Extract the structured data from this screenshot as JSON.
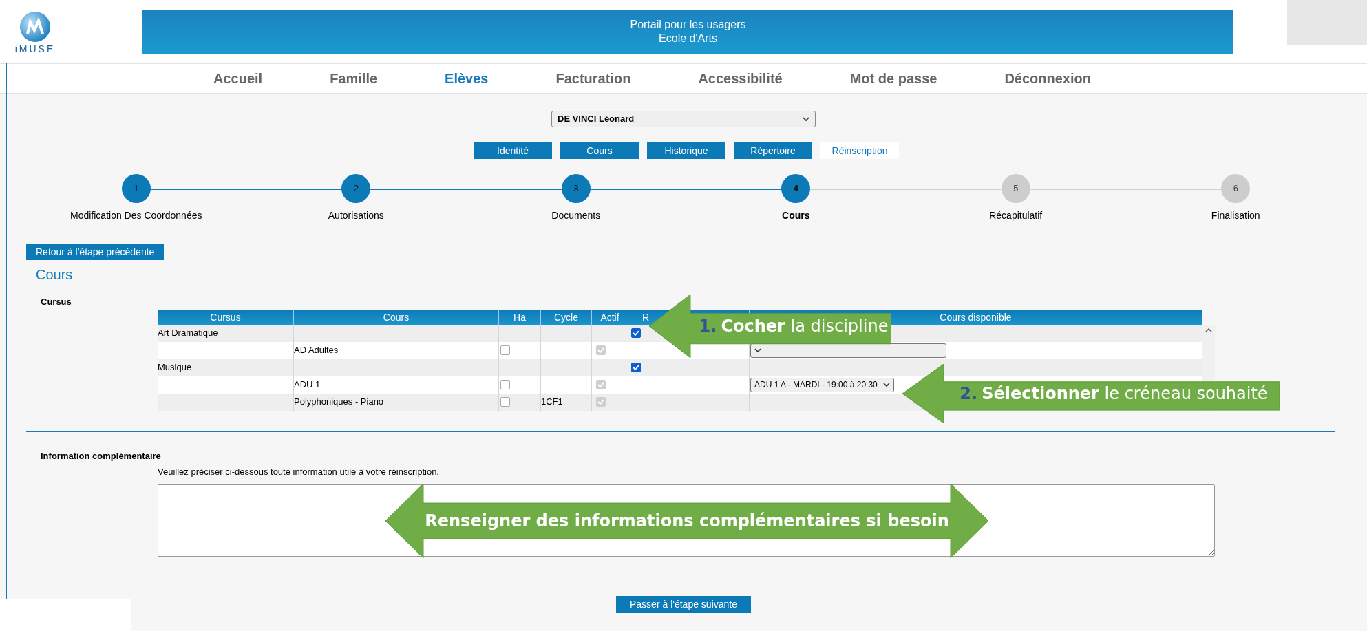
{
  "banner": {
    "title": "Portail pour les usagers",
    "subtitle": "Ecole d'Arts"
  },
  "logo": {
    "text": "iMUSE"
  },
  "nav": [
    {
      "label": "Accueil",
      "selected": false
    },
    {
      "label": "Famille",
      "selected": false
    },
    {
      "label": "Elèves",
      "selected": true
    },
    {
      "label": "Facturation",
      "selected": false
    },
    {
      "label": "Accessibilité",
      "selected": false
    },
    {
      "label": "Mot de passe",
      "selected": false
    },
    {
      "label": "Déconnexion",
      "selected": false
    }
  ],
  "student_select": {
    "value": "DE VINCI Léonard"
  },
  "tabs": [
    {
      "label": "Identité",
      "selected": false
    },
    {
      "label": "Cours",
      "selected": false
    },
    {
      "label": "Historique",
      "selected": false
    },
    {
      "label": "Répertoire",
      "selected": false
    },
    {
      "label": "Réinscription",
      "selected": true
    }
  ],
  "steps": [
    {
      "number": "1",
      "label": "Modification Des Coordonnées",
      "reached": true,
      "selected": false
    },
    {
      "number": "2",
      "label": "Autorisations",
      "reached": true,
      "selected": false
    },
    {
      "number": "3",
      "label": "Documents",
      "reached": true,
      "selected": false
    },
    {
      "number": "4",
      "label": "Cours",
      "reached": true,
      "selected": true
    },
    {
      "number": "5",
      "label": "Récapitulatif",
      "reached": false,
      "selected": false
    },
    {
      "number": "6",
      "label": "Finalisation",
      "reached": false,
      "selected": false
    }
  ],
  "back_button": "Retour à l'étape précédente",
  "section_title": "Cours",
  "cursus_label": "Cursus",
  "table": {
    "columns": [
      "Cursus",
      "Cours",
      "Ha",
      "Cycle",
      "Actif",
      "R",
      "Cours disponible"
    ],
    "rows": [
      {
        "kind": "group",
        "cursus": "Art Dramatique",
        "checked": true
      },
      {
        "kind": "course",
        "cours": "AD Adultes",
        "ha_checked": false,
        "actif_checked": true,
        "has_select": true
      },
      {
        "kind": "group",
        "cursus": "Musique",
        "checked": true
      },
      {
        "kind": "course",
        "cours": "ADU 1",
        "ha_checked": false,
        "actif_checked": true,
        "has_select": true,
        "select_value": "ADU 1 A - MARDI - 19:00 à 20:30"
      },
      {
        "kind": "course",
        "cours": "Polyphoniques - Piano",
        "ha_checked": false,
        "cycle": "1CF1",
        "actif_checked": true,
        "has_select": false
      }
    ]
  },
  "info": {
    "title": "Information complémentaire",
    "hint": "Veuillez préciser ci-dessous toute information utile à votre réinscription."
  },
  "next_button": "Passer à l'étape suivante",
  "callouts": [
    {
      "kind": "left",
      "number": "1.",
      "text": "**Cocher** la discipline"
    },
    {
      "kind": "left",
      "number": "2.",
      "text": "**Sélectionner** le créneau souhaité"
    },
    {
      "kind": "both",
      "text": "Renseigner des informations complémentaires si besoin"
    }
  ]
}
